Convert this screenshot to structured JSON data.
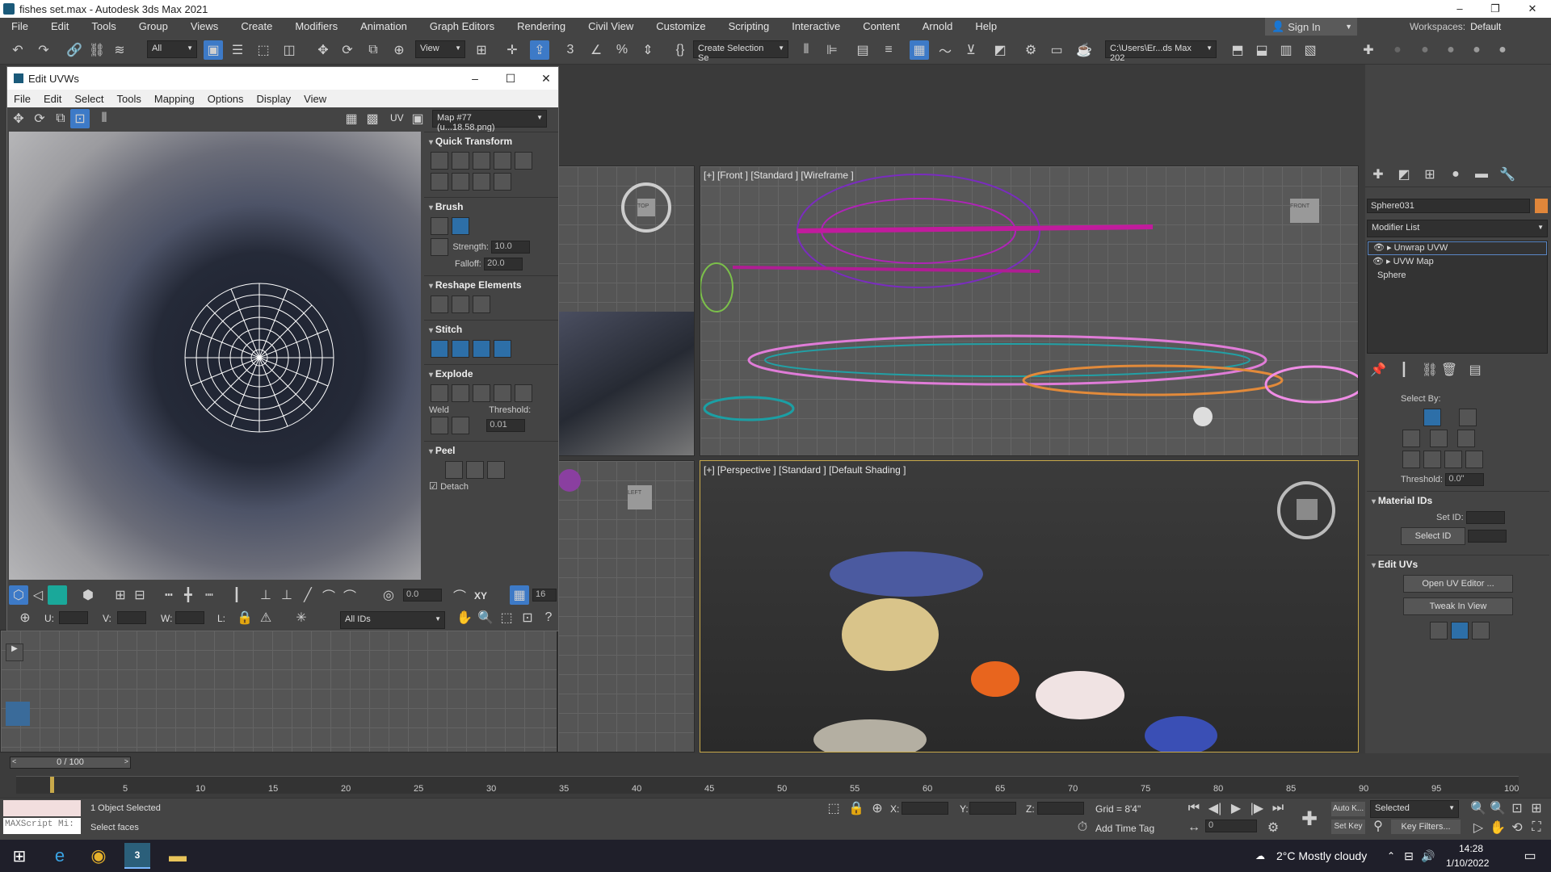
{
  "window": {
    "title": "fishes set.max - Autodesk 3ds Max 2021"
  },
  "menu": [
    "File",
    "Edit",
    "Tools",
    "Group",
    "Views",
    "Create",
    "Modifiers",
    "Animation",
    "Graph Editors",
    "Rendering",
    "Civil View",
    "Customize",
    "Scripting",
    "Interactive",
    "Content",
    "Arnold",
    "Help"
  ],
  "signin": "Sign In",
  "workspaces": {
    "label": "Workspaces:",
    "value": "Default"
  },
  "toolbar": {
    "filter": "All",
    "refcoord": "View",
    "selset": "Create Selection Se",
    "path": "C:\\Users\\Er...ds Max 202"
  },
  "uvw": {
    "title": "Edit UVWs",
    "menu": [
      "File",
      "Edit",
      "Select",
      "Tools",
      "Mapping",
      "Options",
      "Display",
      "View"
    ],
    "uv_label": "UV",
    "map": "Map #77 (u...18.58.png)",
    "rollouts": {
      "quick": "Quick Transform",
      "brush": "Brush",
      "strength_label": "Strength:",
      "strength": "10.0",
      "falloff_label": "Falloff:",
      "falloff": "20.0",
      "reshape": "Reshape Elements",
      "stitch": "Stitch",
      "explode": "Explode",
      "weld": "Weld",
      "threshold_label": "Threshold:",
      "threshold": "0.01",
      "peel": "Peel",
      "detach": "Detach"
    },
    "bottom": {
      "angle": "0.0",
      "xy": "XY",
      "count": "16",
      "u": "U:",
      "v": "V:",
      "w": "W:",
      "l": "L:",
      "ids": "All IDs"
    }
  },
  "viewports": {
    "front": "[+] [Front ] [Standard ] [Wireframe ]",
    "persp": "[+] [Perspective ] [Standard ] [Default Shading ]",
    "top_cube": "TOP",
    "front_cube": "FRONT",
    "left_cube": "LEFT"
  },
  "cmd": {
    "object": "Sphere031",
    "modlist": "Modifier List",
    "stack": [
      "Unwrap UVW",
      "UVW Map",
      "Sphere"
    ],
    "select_by": "Select By:",
    "threshold_label": "Threshold:",
    "threshold": "0.0\"",
    "matids": "Material IDs",
    "set_id": "Set ID:",
    "select_id": "Select ID",
    "edit_uvs": "Edit UVs",
    "open_uv": "Open UV Editor ...",
    "tweak": "Tweak In View",
    "object_color": "#e0863a"
  },
  "timeline": {
    "frame": "0 / 100",
    "ticks": [
      "5",
      "10",
      "15",
      "20",
      "25",
      "30",
      "35",
      "40",
      "45",
      "50",
      "55",
      "60",
      "65",
      "70",
      "75",
      "80",
      "85",
      "90",
      "95",
      "100"
    ]
  },
  "status": {
    "maxscript": "MAXScript Mi:",
    "selected": "1 Object Selected",
    "prompt": "Select faces",
    "x": "X:",
    "y": "Y:",
    "z": "Z:",
    "grid": "Grid = 8'4\"",
    "addtime": "Add Time Tag",
    "autokey": "Auto K...",
    "selected_dd": "Selected",
    "setkey": "Set Key",
    "keyfilters": "Key Filters...",
    "frame_field": "0"
  },
  "taskbar": {
    "weather": "2°C  Mostly cloudy",
    "time": "14:28",
    "date": "1/10/2022"
  }
}
